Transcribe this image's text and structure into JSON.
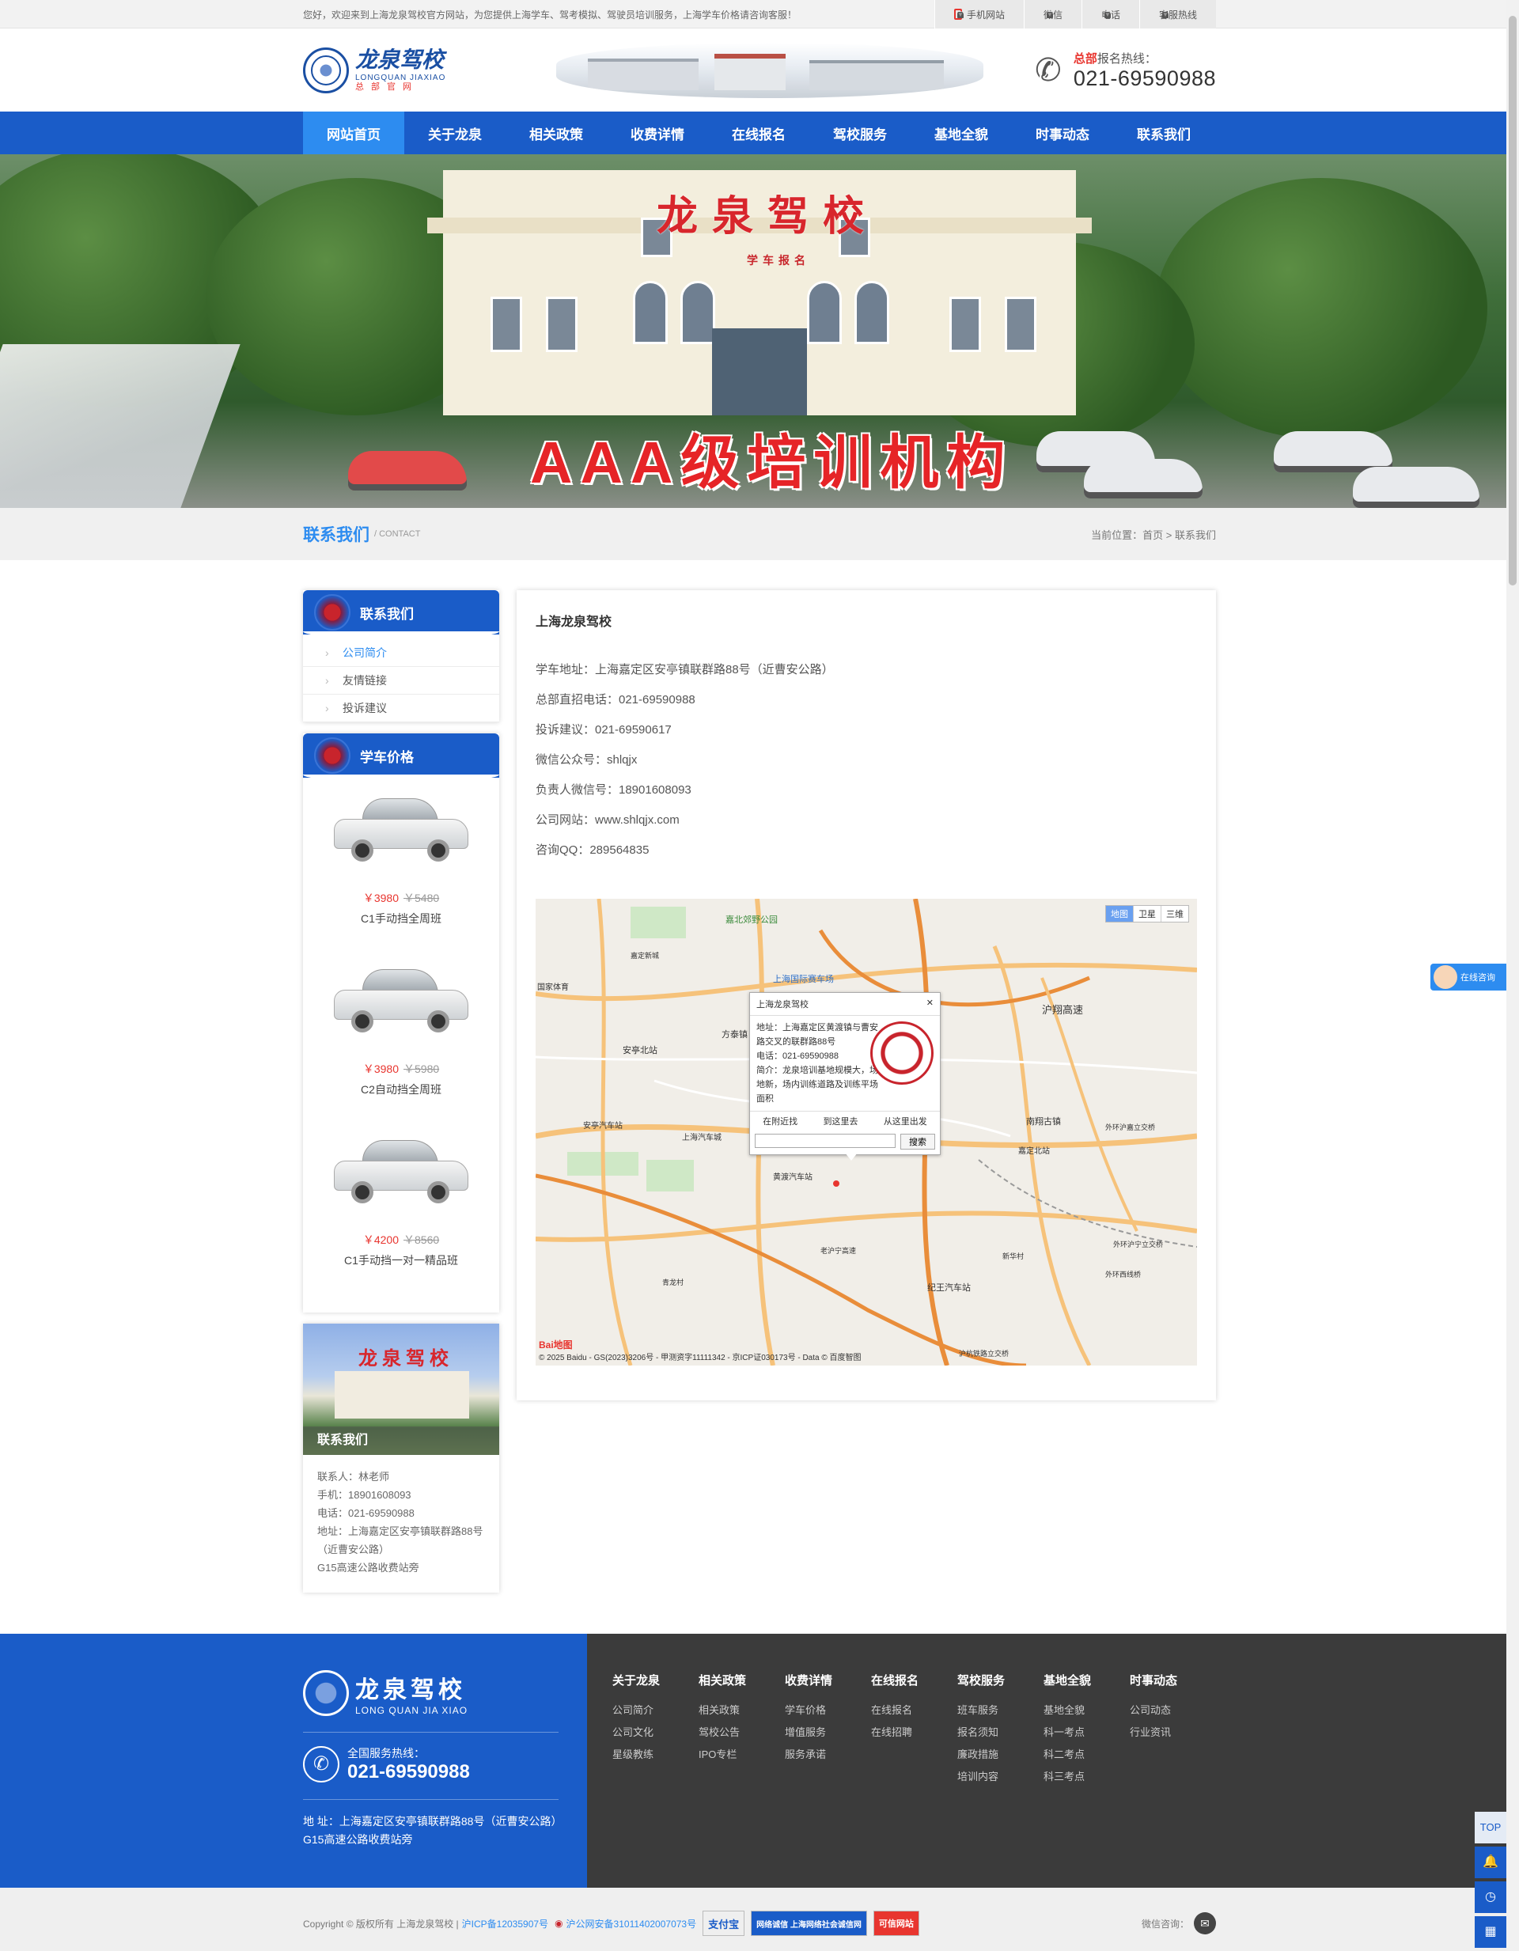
{
  "topbar": {
    "welcome": "您好，欢迎来到上海龙泉驾校官方网站，为您提供上海学车、驾考模拟、驾驶员培训服务，上海学车价格请咨询客服！",
    "links": [
      "手机网站",
      "微信",
      "电话",
      "客服热线"
    ]
  },
  "header": {
    "logo_cn": "龙泉驾校",
    "logo_en": "LONGQUAN JIAXIAO",
    "logo_sub": "总部官网",
    "hotline_prefix": "总部",
    "hotline_label": "报名热线：",
    "hotline_number": "021-69590988"
  },
  "nav": {
    "items": [
      "网站首页",
      "关于龙泉",
      "相关政策",
      "收费详情",
      "在线报名",
      "驾校服务",
      "基地全貌",
      "时事动态",
      "联系我们"
    ],
    "active_index": 0
  },
  "banner": {
    "school_name": "龙泉驾校",
    "sign": "学车报名",
    "slogan": "AAA级培训机构"
  },
  "band": {
    "title": "联系我们",
    "title_en": "/ CONTACT",
    "crumb": "当前位置：首页 > 联系我们"
  },
  "sidebar": {
    "contact_title": "联系我们",
    "menu": [
      "公司简介",
      "友情链接",
      "投诉建议"
    ],
    "price_title": "学车价格",
    "prices": [
      {
        "price": "￥3980",
        "old": "￥5480",
        "name": "C1手动挡全周班"
      },
      {
        "price": "￥3980",
        "old": "￥5980",
        "name": "C2自动挡全周班"
      },
      {
        "price": "￥4200",
        "old": "￥8560",
        "name": "C1手动挡一对一精品班"
      }
    ],
    "contact_img_title": "龙泉驾校",
    "contact_img_label": "联系我们",
    "contact_info": [
      "联系人：林老师",
      "手机：18901608093",
      "电话：021-69590988",
      "地址：上海嘉定区安亭镇联群路88号（近曹安公路）",
      "G15高速公路收费站旁"
    ]
  },
  "content": {
    "title": "上海龙泉驾校",
    "lines": [
      "学车地址：上海嘉定区安亭镇联群路88号（近曹安公路）",
      "总部直招电话：021-69590988",
      "投诉建议：021-69590617",
      "微信公众号：shlqjx",
      "负责人微信号：18901608093",
      "公司网站：www.shlqjx.com",
      "咨询QQ：289564835"
    ]
  },
  "map": {
    "types": [
      "地图",
      "卫星",
      "三维"
    ],
    "popup_title": "上海龙泉驾校",
    "popup_lines": [
      "地址：上海嘉定区黄渡镇与曹安路交叉的联群路88号",
      "电话：021-69590988",
      "简介：龙泉培训基地规模大，场地新，场内训练道路及训练平场面积"
    ],
    "popup_actions": [
      "在附近找",
      "到这里去",
      "从这里出发"
    ],
    "search_btn": "搜索",
    "labels": [
      "嘉北郊野公园",
      "上海国际赛车场",
      "安亭北站",
      "方泰镇",
      "沪翔高速",
      "安亭汽车站",
      "上海汽车城",
      "黄渡汽车站",
      "嘉定北站",
      "南翔古镇",
      "外环沪嘉立交桥",
      "外环沪宁立交桥",
      "外环西线桥",
      "老沪宁高速",
      "纪王汽车站",
      "青龙村",
      "新华村",
      "沪杭铁路立交桥",
      "国家体育",
      "嘉定新城"
    ],
    "logo": "Bai地图",
    "copyright": "© 2025 Baidu - GS(2023)3206号 - 甲测资字11111342 - 京ICP证030173号 - Data © 百度智图"
  },
  "footer": {
    "logo_cn": "龙泉驾校",
    "logo_en": "LONG QUAN JIA XIAO",
    "hot_label": "全国服务热线：",
    "hot_number": "021-69590988",
    "address": "地 址：上海嘉定区安亭镇联群路88号（近曹安公路）G15高速公路收费站旁",
    "columns": [
      {
        "title": "关于龙泉",
        "links": [
          "公司简介",
          "公司文化",
          "星级教练"
        ]
      },
      {
        "title": "相关政策",
        "links": [
          "相关政策",
          "驾校公告",
          "IPO专栏"
        ]
      },
      {
        "title": "收费详情",
        "links": [
          "学车价格",
          "增值服务",
          "服务承诺"
        ]
      },
      {
        "title": "在线报名",
        "links": [
          "在线报名",
          "在线招聘"
        ]
      },
      {
        "title": "驾校服务",
        "links": [
          "班车服务",
          "报名须知",
          "廉政措施",
          "培训内容"
        ]
      },
      {
        "title": "基地全貌",
        "links": [
          "基地全貌",
          "科一考点",
          "科二考点",
          "科三考点"
        ]
      },
      {
        "title": "时事动态",
        "links": [
          "公司动态",
          "行业资讯"
        ]
      }
    ]
  },
  "bottom": {
    "copyright": "Copyright © 版权所有 上海龙泉驾校 |",
    "icp": "沪ICP备12035907号",
    "police": "沪公网安备31011402007073号",
    "badges": [
      "支付宝",
      "网络诚信 上海网络社会诚信网",
      "可信网站"
    ],
    "wechat": "微信咨询："
  },
  "float": {
    "online": "在线咨询",
    "top": "TOP"
  }
}
